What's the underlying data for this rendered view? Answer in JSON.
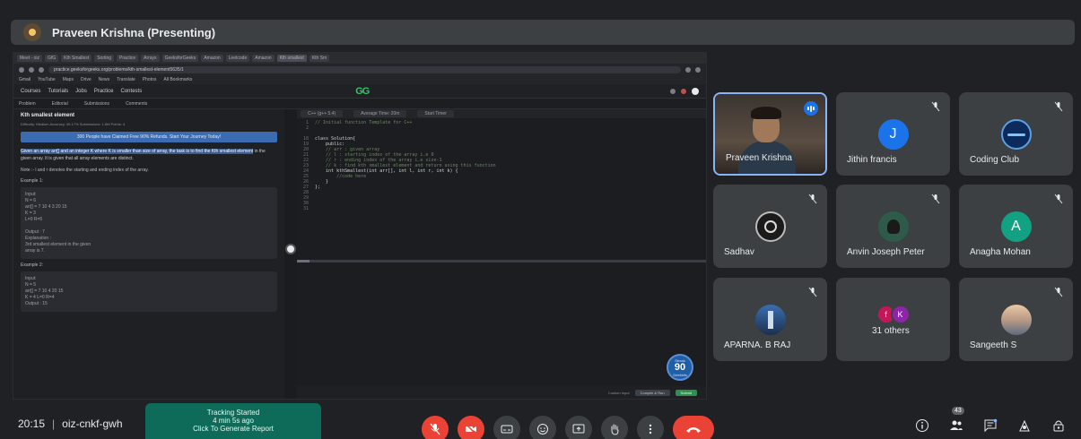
{
  "presenter": {
    "name": "Praveen Krishna (Presenting)"
  },
  "screen": {
    "tabs": [
      "Meet - oiz",
      "GfG",
      "Kth Smallest",
      "Sorting",
      "Practice",
      "Arrays",
      "GeeksforGeeks",
      "Amazon",
      "Leetcode",
      "Amazon",
      "Kth smallest",
      "Kth Sm"
    ],
    "url": "practice.geeksforgeeks.org/problems/kth-smallest-element5635/1",
    "bookmarks": [
      "Gmail",
      "YouTube",
      "Maps",
      "Drive",
      "News",
      "Translate",
      "Photos",
      "All Bookmarks"
    ],
    "site_left": [
      "Courses",
      "Tutorials",
      "Jobs",
      "Practice",
      "Contests"
    ],
    "site_logo": "GG",
    "tool_tabs": [
      "Problem",
      "Editorial",
      "Submissions",
      "Comments"
    ],
    "editor_tabs": [
      "C++ (g++ 5.4)",
      "Average Time: 20m",
      "Start Timer"
    ],
    "question": {
      "title": "Kth smallest element",
      "meta": "Difficulty: Medium   Accuracy: 35.17%   Submissions: 1.6M   Points: 4",
      "banner": "300 People have Claimed Free 90% Refunds. Start Your Journey Today!",
      "text_highlight": "Given an array arr[] and an integer K where K is smaller than size of array, the task is to find the Kth smallest element",
      "text_rest": " in the given array. It is given that all array elements are distinct.",
      "note": "Note :- l and r denotes the starting and ending index of the array.",
      "example1_label": "Example 1:",
      "example1": [
        "Input:",
        "N = 6",
        "arr[] = 7 10 4 3 20 15",
        "K = 3",
        "L=0 R=5",
        "",
        "Output : 7",
        "Explanation :",
        "3rd smallest element in the given",
        "array is 7."
      ],
      "example2_label": "Example 2:",
      "example2": [
        "Input:",
        "N = 5",
        "arr[] = 7 10 4 20 15",
        "K = 4  L=0 R=4",
        "Output : 15"
      ]
    },
    "code": {
      "gutter": [
        "1",
        "2",
        "",
        "18",
        "19",
        "20",
        "21",
        "22",
        "23",
        "24",
        "25",
        "26",
        "27",
        "28",
        "29",
        "30",
        "31"
      ],
      "lines": [
        "// Initial function Template for C++",
        "",
        "",
        "class Solution{",
        "    public:",
        "    // arr : given array",
        "    // l : starting index of the array i.e 0",
        "    // r : ending index of the array i.e size-1",
        "    // k : find kth smallest element and return using this function",
        "    int kthSmallest(int arr[], int l, int r, int k) {",
        "        //code here",
        "    }",
        "};",
        "",
        "",
        "",
        ""
      ]
    },
    "editor_buttons": {
      "custom": "Custom Input",
      "compile": "Compile & Run",
      "submit": "Submit"
    },
    "score": {
      "top": "Streak",
      "value": "90",
      "bottom": "Geekbits"
    }
  },
  "participants": [
    {
      "name": "Praveen Krishna",
      "type": "video"
    },
    {
      "name": "Jithin francis",
      "initial": "J",
      "color": "#1a73e8",
      "muted": true
    },
    {
      "name": "Coding Club",
      "type": "logo",
      "muted": true
    },
    {
      "name": "Sadhav",
      "type": "logo-dark",
      "muted": true
    },
    {
      "name": "Anvin Joseph Peter",
      "type": "photo",
      "muted": true
    },
    {
      "name": "Anagha Mohan",
      "initial": "A",
      "color": "#12a182",
      "muted": true
    },
    {
      "name": "APARNA. B RAJ",
      "type": "photo-blue",
      "muted": true
    },
    {
      "name": "31 others",
      "type": "others",
      "initials": [
        "f",
        "K"
      ]
    },
    {
      "name": "Sangeeth S",
      "type": "photo-sky",
      "muted": true
    }
  ],
  "bottom": {
    "time": "20:15",
    "meeting_code": "oiz-cnkf-gwh",
    "tracking": [
      "Tracking Started",
      "4 min 5s ago",
      "Click To Generate Report"
    ],
    "participant_count": "43"
  }
}
